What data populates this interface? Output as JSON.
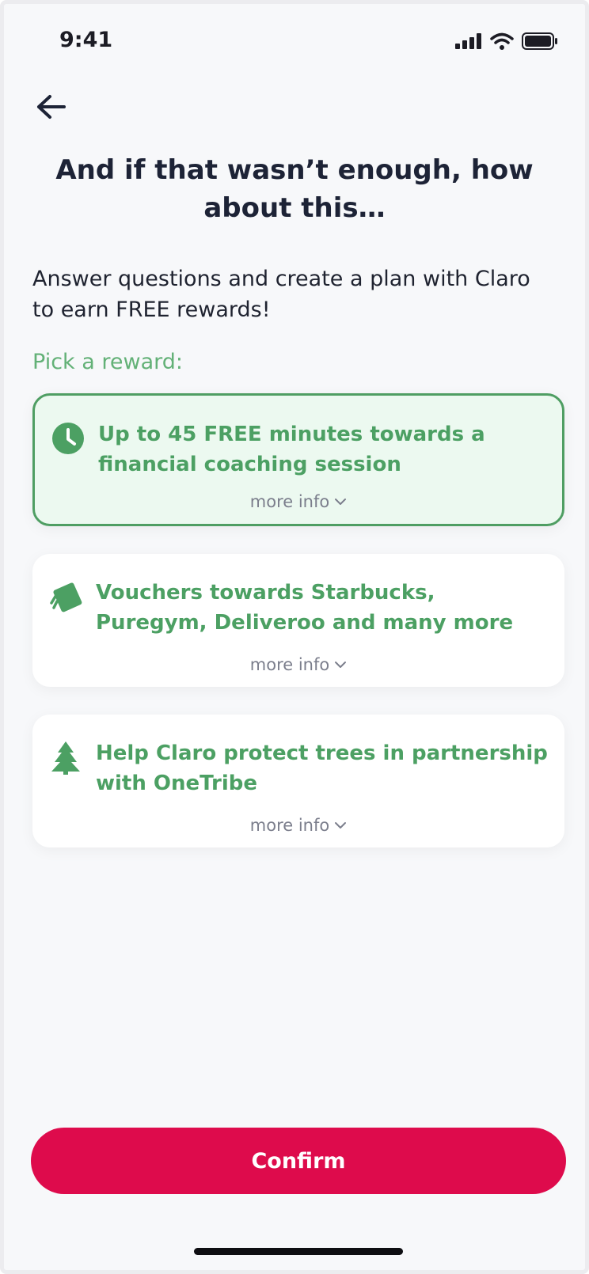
{
  "status_bar": {
    "time": "9:41",
    "icons": [
      "signal-icon",
      "wifi-icon",
      "battery-icon"
    ]
  },
  "nav": {
    "back_icon": "arrow-left-icon"
  },
  "headline": "And if that wasn’t enough, how about this…",
  "intro": "Answer questions and create a plan with Claro to earn FREE rewards!",
  "pick_label": "Pick a reward:",
  "rewards": [
    {
      "icon": "clock-icon",
      "title": "Up to 45 FREE minutes towards a financial coaching session",
      "more_info": "more info",
      "selected": true
    },
    {
      "icon": "voucher-icon",
      "title": "Vouchers towards Starbucks, Puregym, Deliveroo and many more",
      "more_info": "more info",
      "selected": false
    },
    {
      "icon": "tree-icon",
      "title": "Help Claro protect trees in partnership with OneTribe",
      "more_info": "more info",
      "selected": false
    }
  ],
  "confirm_label": "Confirm",
  "colors": {
    "accent_green": "#4ca063",
    "selected_bg": "#ecf9f0",
    "confirm_bg": "#de0b4c",
    "heading": "#1d2336"
  }
}
